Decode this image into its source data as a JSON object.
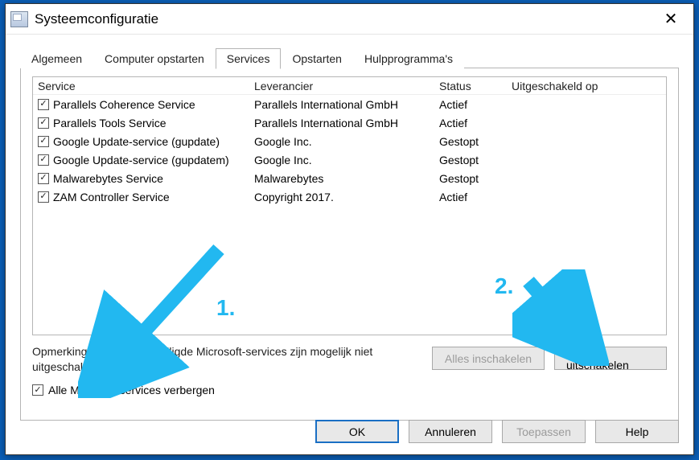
{
  "window": {
    "title": "Systeemconfiguratie"
  },
  "tabs": {
    "general": "Algemeen",
    "boot": "Computer opstarten",
    "services": "Services",
    "startup": "Opstarten",
    "tools": "Hulpprogramma's",
    "active": "services"
  },
  "columns": {
    "service": "Service",
    "vendor": "Leverancier",
    "status": "Status",
    "disabled_on": "Uitgeschakeld op"
  },
  "services": [
    {
      "checked": true,
      "name": "Parallels Coherence Service",
      "vendor": "Parallels International GmbH",
      "status": "Actief",
      "disabled_on": ""
    },
    {
      "checked": true,
      "name": "Parallels Tools Service",
      "vendor": "Parallels International GmbH",
      "status": "Actief",
      "disabled_on": ""
    },
    {
      "checked": true,
      "name": "Google Update-service (gupdate)",
      "vendor": "Google Inc.",
      "status": "Gestopt",
      "disabled_on": ""
    },
    {
      "checked": true,
      "name": "Google Update-service (gupdatem)",
      "vendor": "Google Inc.",
      "status": "Gestopt",
      "disabled_on": ""
    },
    {
      "checked": true,
      "name": "Malwarebytes Service",
      "vendor": "Malwarebytes",
      "status": "Gestopt",
      "disabled_on": ""
    },
    {
      "checked": true,
      "name": "ZAM Controller Service",
      "vendor": "Copyright 2017.",
      "status": "Actief",
      "disabled_on": ""
    }
  ],
  "note_line1": "Opmerking: sommige beveiligde Microsoft-services zijn mogelijk niet",
  "note_line2": "uitgeschakeld.",
  "hide_ms": {
    "checked": true,
    "label": "Alle Microsoft-services verbergen"
  },
  "buttons": {
    "enable_all": "Alles inschakelen",
    "disable_all": "Alles uitschakelen",
    "ok": "OK",
    "cancel": "Annuleren",
    "apply": "Toepassen",
    "help": "Help"
  },
  "annotations": {
    "label1": "1.",
    "label2": "2."
  },
  "colors": {
    "annotation": "#22b8f0",
    "frame": "#0b5fb8"
  }
}
